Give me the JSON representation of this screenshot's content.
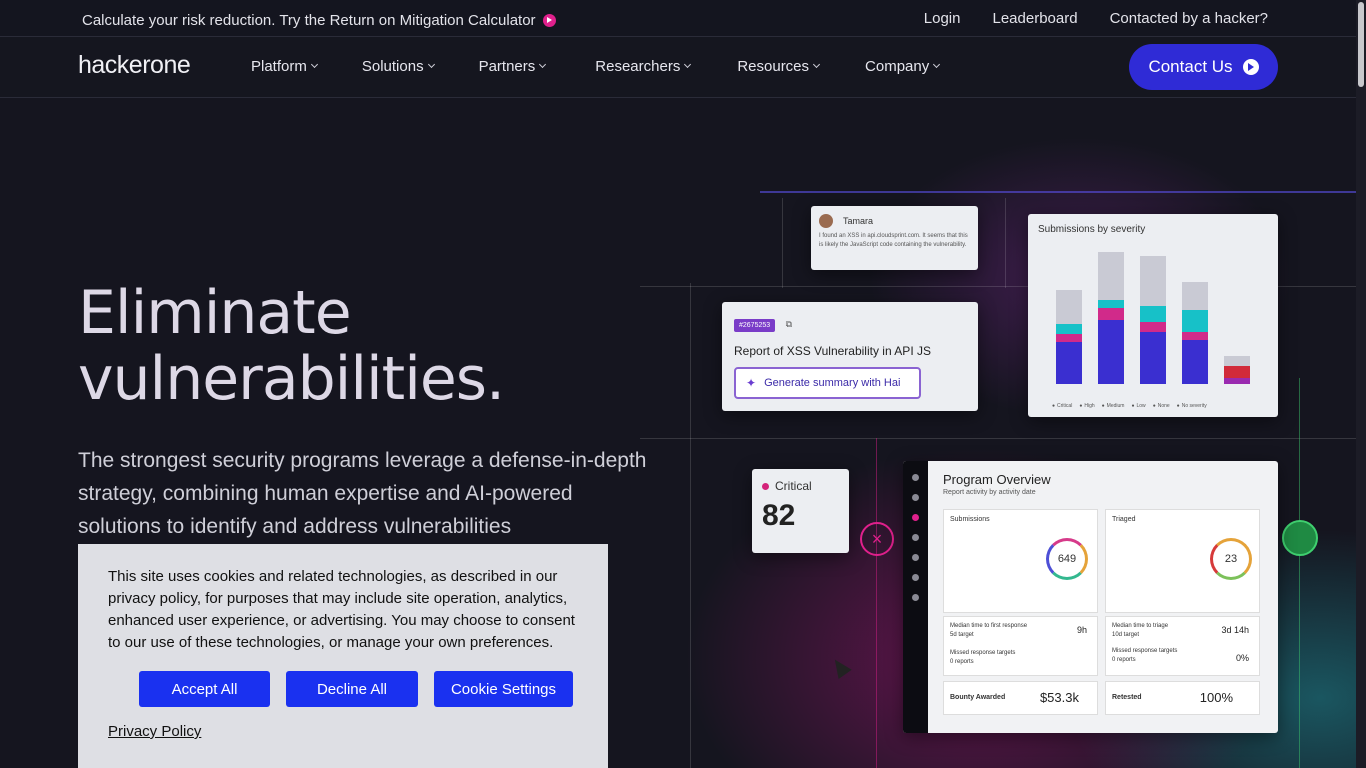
{
  "announcement": {
    "text": "Calculate your risk reduction. Try the Return on Mitigation Calculator"
  },
  "toplinks": [
    "Login",
    "Leaderboard",
    "Contacted by a hacker?"
  ],
  "nav": {
    "logo_part1": "h",
    "logo_part2": "ackerone",
    "items": [
      "Platform",
      "Solutions",
      "Partners",
      "Researchers",
      "Resources",
      "Company"
    ],
    "contact_label": "Contact Us"
  },
  "hero": {
    "title": "Eliminate vulnerabilities.",
    "subtitle": "The strongest security programs leverage a defense-in-depth strategy, combining human expertise and AI-powered solutions to identify and address vulnerabilities"
  },
  "mock": {
    "message": {
      "author": "Tamara",
      "text": "I found an XSS in api.cloudsprint.com. It seems that this is likely the JavaScript code containing the vulnerability."
    },
    "report": {
      "id": "#2675253",
      "title": "Report of XSS Vulnerability in API JS",
      "hai_button": "Generate summary with Hai"
    },
    "severity": {
      "title": "Submissions by severity",
      "legend": [
        "Critical",
        "High",
        "Medium",
        "Low",
        "None",
        "No severity"
      ]
    },
    "critical": {
      "label": "Critical",
      "value": "82"
    },
    "overview": {
      "title": "Program Overview",
      "subtitle": "Report activity by activity date",
      "submissions_label": "Submissions",
      "submissions_total": "649",
      "triaged_label": "Triaged",
      "triaged_total": "23",
      "median_first": "Median time to first response",
      "first_value": "9h",
      "first_target": "5d target",
      "median_triage": "Median time to triage",
      "triage_value": "3d 14h",
      "triage_target": "10d target",
      "missed_label": "Missed response targets",
      "missed_left": "0 reports",
      "missed_right": "0 reports",
      "missed_pct": "0%",
      "bounty_label": "Bounty Awarded",
      "bounty_value": "$53.3k",
      "retested_label": "Retested",
      "retested_value": "100%"
    }
  },
  "colors": {
    "brand": "#2f2bd6",
    "accent_pink": "#e0208c",
    "cookie_button": "#1a31f0"
  },
  "cookie": {
    "text": "This site uses cookies and related technologies, as described in our privacy policy, for purposes that may include site operation, analytics, enhanced user experience, or advertising. You may choose to consent to our use of these technologies, or manage your own preferences.",
    "accept": "Accept All",
    "decline": "Decline All",
    "settings": "Cookie Settings",
    "policy_link": "Privacy Policy"
  }
}
